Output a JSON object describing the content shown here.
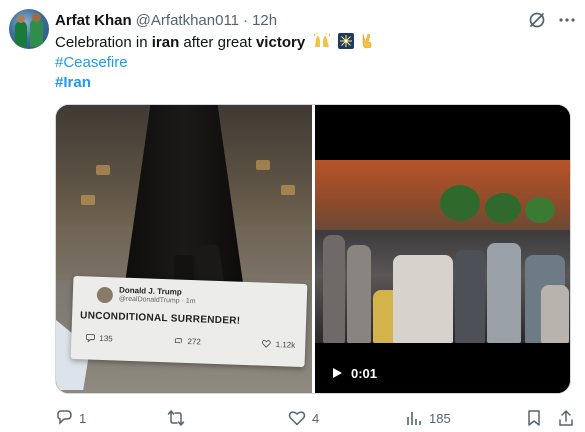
{
  "author": {
    "name": "Arfat Khan",
    "handle": "@Arfatkhan011",
    "separator": "·",
    "time": "12h"
  },
  "tweet": {
    "line1": {
      "part1": "Celebration in ",
      "part2": "iran",
      "part3": " after great ",
      "part4": "victory",
      "emojis": [
        "raised-hands-emoji",
        "fireworks-emoji",
        "victory-hand-emoji"
      ]
    },
    "hashtag1": "#Ceasefire",
    "hashtag2": "#Iran"
  },
  "media": {
    "left_image": {
      "poster_name": "Donald J. Trump",
      "poster_handle": "@realDonaldTrump · 1m",
      "poster_text": "UNCONDITIONAL SURRENDER!",
      "replies": "135",
      "reposts": "272",
      "likes": "1.12k"
    },
    "video": {
      "duration": "0:01",
      "play_icon": "play-icon"
    }
  },
  "actions": {
    "replies": "1",
    "reposts": "",
    "likes": "4",
    "views": "185"
  },
  "colors": {
    "text_primary": "#0f1419",
    "text_secondary": "#536471",
    "link": "#1d9bf0",
    "border": "#cfd9de"
  }
}
